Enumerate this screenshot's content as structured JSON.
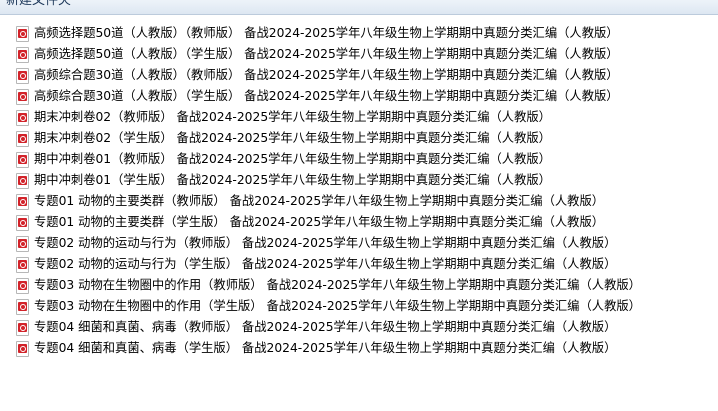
{
  "folder": {
    "title": "新建文件夹"
  },
  "files": [
    "高频选择题50道（人教版）（教师版） 备战2024-2025学年八年级生物上学期期中真题分类汇编（人教版）",
    "高频选择题50道（人教版）（学生版） 备战2024-2025学年八年级生物上学期期中真题分类汇编（人教版）",
    "高频综合题30道（人教版）（教师版） 备战2024-2025学年八年级生物上学期期中真题分类汇编（人教版）",
    "高频综合题30道（人教版）（学生版） 备战2024-2025学年八年级生物上学期期中真题分类汇编（人教版）",
    "期末冲刺卷02（教师版） 备战2024-2025学年八年级生物上学期期中真题分类汇编（人教版）",
    "期末冲刺卷02（学生版） 备战2024-2025学年八年级生物上学期期中真题分类汇编（人教版）",
    "期中冲刺卷01（教师版） 备战2024-2025学年八年级生物上学期期中真题分类汇编（人教版）",
    "期中冲刺卷01（学生版） 备战2024-2025学年八年级生物上学期期中真题分类汇编（人教版）",
    "专题01 动物的主要类群（教师版） 备战2024-2025学年八年级生物上学期期中真题分类汇编（人教版）",
    "专题01 动物的主要类群（学生版） 备战2024-2025学年八年级生物上学期期中真题分类汇编（人教版）",
    "专题02 动物的运动与行为（教师版） 备战2024-2025学年八年级生物上学期期中真题分类汇编（人教版）",
    "专题02 动物的运动与行为（学生版） 备战2024-2025学年八年级生物上学期期中真题分类汇编（人教版）",
    "专题03 动物在生物圈中的作用（教师版） 备战2024-2025学年八年级生物上学期期中真题分类汇编（人教版）",
    "专题03 动物在生物圈中的作用（学生版） 备战2024-2025学年八年级生物上学期期中真题分类汇编（人教版）",
    "专题04 细菌和真菌、病毒（教师版） 备战2024-2025学年八年级生物上学期期中真题分类汇编（人教版）",
    "专题04 细菌和真菌、病毒（学生版） 备战2024-2025学年八年级生物上学期期中真题分类汇编（人教版）"
  ]
}
